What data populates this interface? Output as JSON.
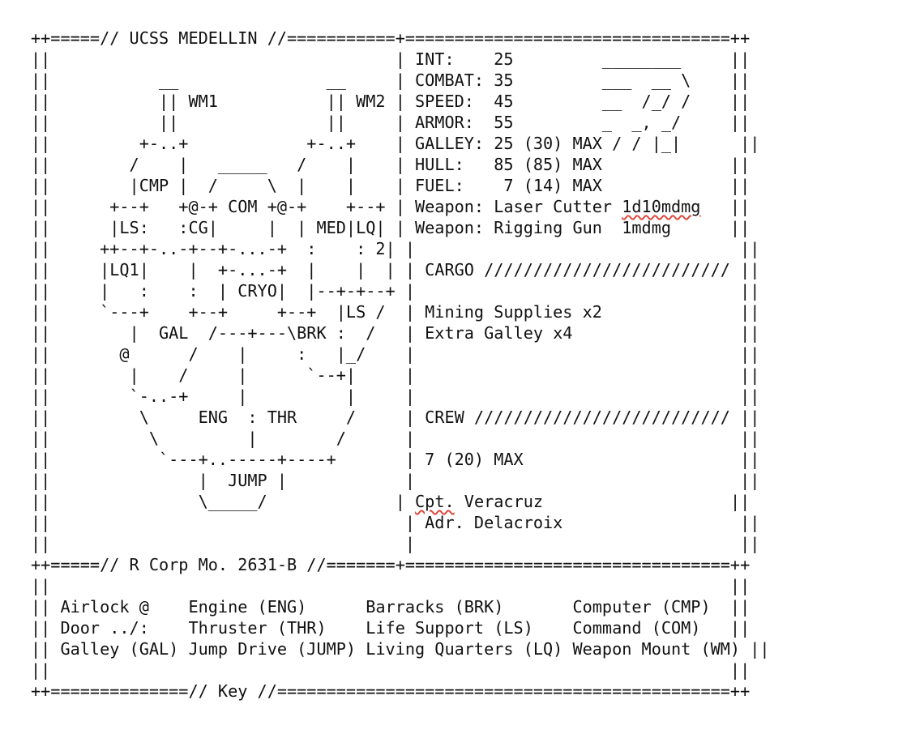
{
  "ship": {
    "name": "UCSS MEDELLIN",
    "registry": "R Corp Mo. 2631-B"
  },
  "stats": {
    "int": "25",
    "combat": "35",
    "speed": "45",
    "armor": "55",
    "galley": "25 (30) MAX",
    "hull": "85 (85) MAX",
    "fuel": " 7 (14) MAX"
  },
  "weapons": [
    {
      "name": "Laser Cutter",
      "damage": "1d10mdmg"
    },
    {
      "name": "Rigging Gun",
      "damage": "1mdmg"
    }
  ],
  "cargo": {
    "heading": "CARGO",
    "items": [
      "Mining Supplies x2",
      "Extra Galley x4"
    ]
  },
  "crew": {
    "heading": "CREW",
    "count": "7 (20) MAX",
    "members": [
      "Cpt. Veracruz",
      "Adr. Delacroix"
    ]
  },
  "key_title": "Key",
  "key": [
    [
      "Airlock @",
      "Engine (ENG)",
      "Barracks (BRK)",
      "Computer (CMP)"
    ],
    [
      "Door ../:",
      "Thruster (THR)",
      "Life Support (LS)",
      "Command (COM)"
    ],
    [
      "Galley (GAL)",
      "Jump Drive (JUMP)",
      "Living Quarters (LQ)",
      "Weapon Mount (WM)"
    ]
  ],
  "lines": [
    "++=====// UCSS MEDELLIN //===========+=================================++",
    "||                                   | INT:    25         ________     ||",
    "||           __               __     | COMBAT: 35         ___  __ \\    ||",
    "||           || WM1           || WM2 | SPEED:  45         __  /_/ /    ||",
    "||           ||               ||     | ARMOR:  55         _  _, _/     ||",
    "||         +-..+            +-..+    | GALLEY: 25 (30) MAX / / |_|      ||",
    "||        /    |   _____   /    |    | HULL:   85 (85) MAX             ||",
    "||        |CMP |  /     \\  |    |    | FUEL:    7 (14) MAX             ||",
    "||      +--+   +@-+ COM +@-+    +--+ | Weapon: Laser Cutter 1d10mdmg   ||",
    "||      |LS:   :CG|     |  | MED|LQ| | Weapon: Rigging Gun  1mdmg      ||",
    "||     ++--+-..-+--+-...-+  :    : 2| |                                 ||",
    "||     |LQ1|    |  +-...-+  |    |  | | CARGO ///////////////////////// ||",
    "||     |   :    :  | CRYO|  |--+-+--+ |                                 ||",
    "||     `---+    +--+     +--+  |LS /  | Mining Supplies x2              ||",
    "||        |  GAL  /---+---\\BRK :  /   | Extra Galley x4                 ||",
    "||       @      /    |     :   |_/    |                                 ||",
    "||        |    /     |      `--+|     |                                 ||",
    "||        `-..-+     |          |     |                                 ||",
    "||         \\     ENG  : THR     /     | CREW ////////////////////////// ||",
    "||          \\         |        /      |                                 ||",
    "||           `---+..-----+----+       | 7 (20) MAX                      ||",
    "||               |  JUMP |            |                                 ||",
    "||               \\_____/             | Cpt. Veracruz                   ||",
    "||                                    | Adr. Delacroix                  ||",
    "||                                    |                                 ||",
    "++=====// R Corp Mo. 2631-B //=======+=================================++",
    "||                                                                     ||",
    "|| Airlock @    Engine (ENG)      Barracks (BRK)       Computer (CMP)  ||",
    "|| Door ../:    Thruster (THR)    Life Support (LS)    Command (COM)   ||",
    "|| Galley (GAL) Jump Drive (JUMP) Living Quarters (LQ) Weapon Mount (WM) ||",
    "||                                                                     ||",
    "++==============// Key //==============================================++"
  ]
}
